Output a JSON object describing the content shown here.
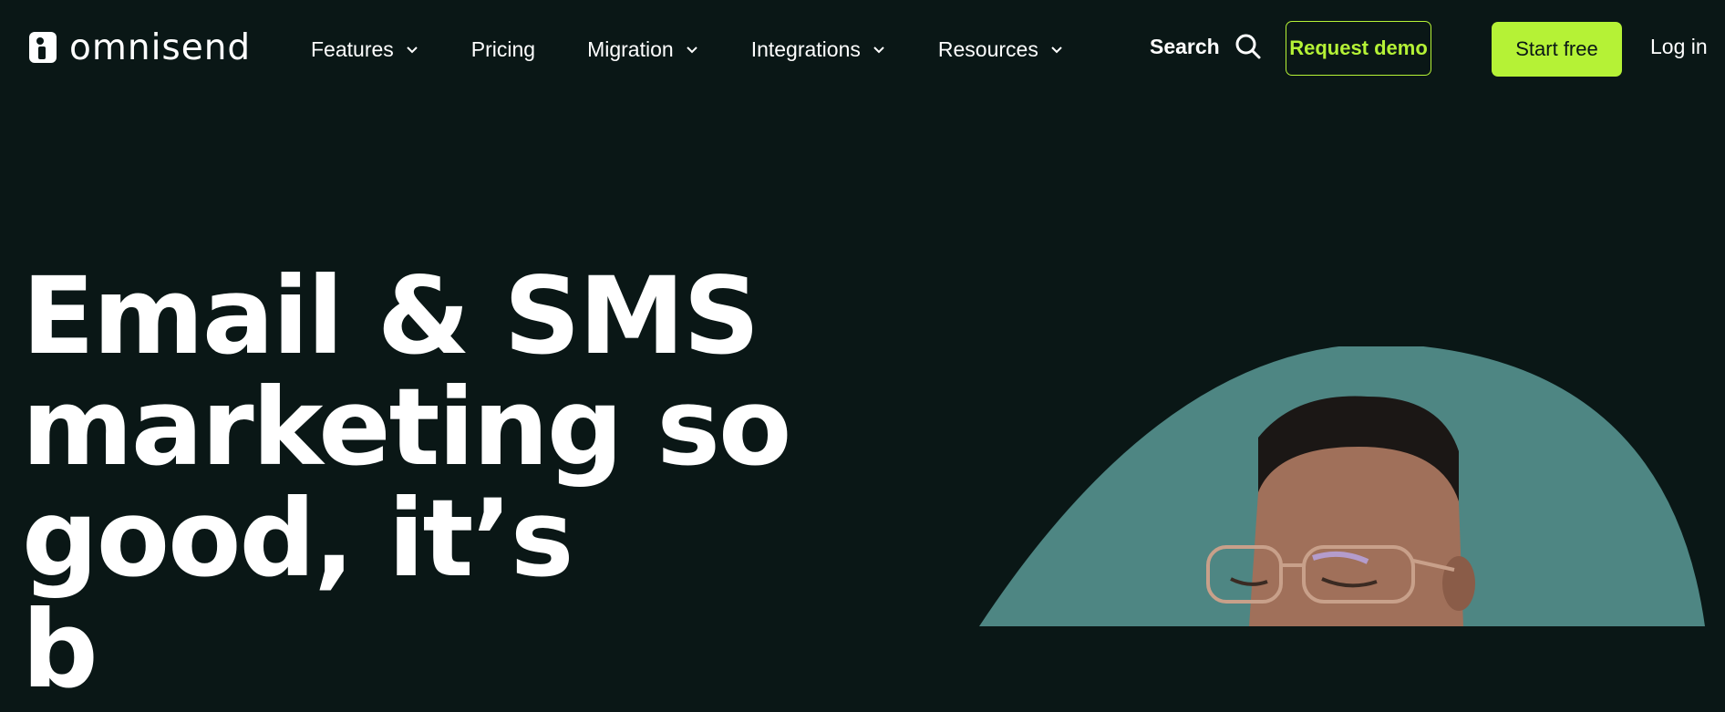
{
  "brand": {
    "name": "omnisend"
  },
  "nav": {
    "items": [
      {
        "label": "Features",
        "has_dropdown": true
      },
      {
        "label": "Pricing",
        "has_dropdown": false
      },
      {
        "label": "Migration",
        "has_dropdown": true
      },
      {
        "label": "Integrations",
        "has_dropdown": true
      },
      {
        "label": "Resources",
        "has_dropdown": true
      }
    ],
    "search_label": "Search",
    "request_demo_label": "Request demo",
    "start_free_label": "Start free",
    "login_label": "Log in"
  },
  "hero": {
    "line1": "Email & SMS",
    "line2": "marketing so",
    "line3": "good, it’s",
    "line4": "b"
  },
  "colors": {
    "background": "#0a1716",
    "accent": "#b5f236",
    "hero_circle": "#4e8683"
  },
  "icons": [
    "logo-icon",
    "chevron-down-icon",
    "search-icon"
  ]
}
